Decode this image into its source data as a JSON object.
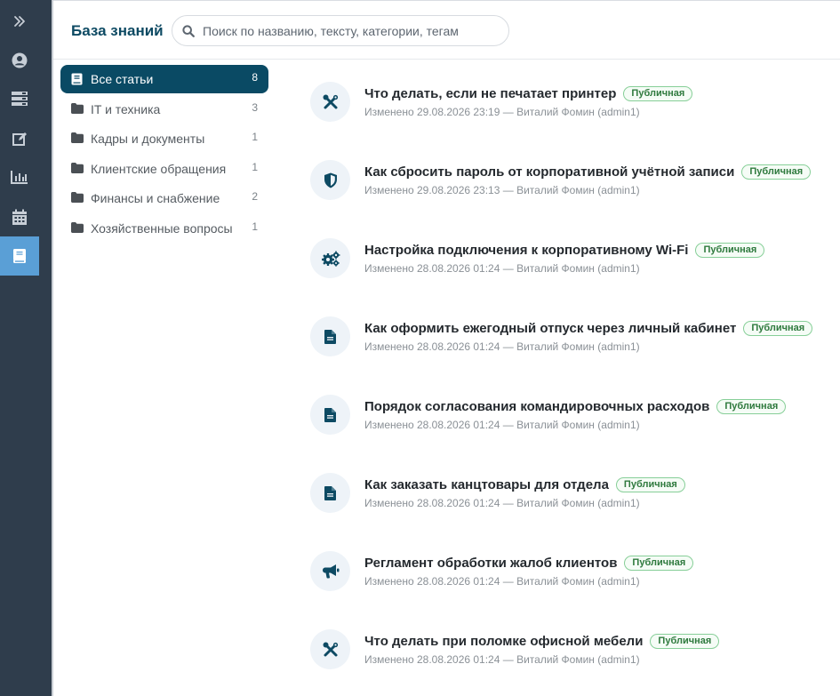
{
  "header": {
    "title": "База знаний",
    "search_placeholder": "Поиск по названию, тексту, категории, тегам"
  },
  "nav_rail": {
    "items": [
      "expand-icon",
      "user-icon",
      "server-icon",
      "edit-icon",
      "chart-icon",
      "calendar-icon",
      "book-icon"
    ],
    "active": "book-icon",
    "active_color": "#5a9fd6",
    "background": "#2f3d4c"
  },
  "categories": [
    {
      "label": "Все статьи",
      "count": "8",
      "active": true
    },
    {
      "label": "IT и техника",
      "count": "3"
    },
    {
      "label": "Кадры и документы",
      "count": "1"
    },
    {
      "label": "Клиентские обращения",
      "count": "1"
    },
    {
      "label": "Финансы и снабжение",
      "count": "2"
    },
    {
      "label": "Хозяйственные вопросы",
      "count": "1"
    }
  ],
  "articles": [
    {
      "icon": "tools-icon",
      "title": "Что делать, если не печатает принтер",
      "badge": "Публичная",
      "meta": "Изменено 29.08.2026 23:19 — Виталий Фомин (admin1)"
    },
    {
      "icon": "shield-icon",
      "title": "Как сбросить пароль от корпоративной учётной записи",
      "badge": "Публичная",
      "meta": "Изменено 29.08.2026 23:13 — Виталий Фомин (admin1)"
    },
    {
      "icon": "cogs-icon",
      "title": "Настройка подключения к корпоративному Wi-Fi",
      "badge": "Публичная",
      "meta": "Изменено 28.08.2026 01:24 — Виталий Фомин (admin1)"
    },
    {
      "icon": "document-icon",
      "title": "Как оформить ежегодный отпуск через личный кабинет",
      "badge": "Публичная",
      "meta": "Изменено 28.08.2026 01:24 — Виталий Фомин (admin1)"
    },
    {
      "icon": "document-icon",
      "title": "Порядок согласования командировочных расходов",
      "badge": "Публичная",
      "meta": "Изменено 28.08.2026 01:24 — Виталий Фомин (admin1)"
    },
    {
      "icon": "document-icon",
      "title": "Как заказать канцтовары для отдела",
      "badge": "Публичная",
      "meta": "Изменено 28.08.2026 01:24 — Виталий Фомин (admin1)"
    },
    {
      "icon": "megaphone-icon",
      "title": "Регламент обработки жалоб клиентов",
      "badge": "Публичная",
      "meta": "Изменено 28.08.2026 01:24 — Виталий Фомин (admin1)"
    },
    {
      "icon": "tools-icon",
      "title": "Что делать при поломке офисной мебели",
      "badge": "Публичная",
      "meta": "Изменено 28.08.2026 01:24 — Виталий Фомин (admin1)"
    }
  ],
  "colors": {
    "accent": "#0a4a64",
    "badge_border": "#87cf98",
    "badge_text": "#2f7a3e"
  }
}
